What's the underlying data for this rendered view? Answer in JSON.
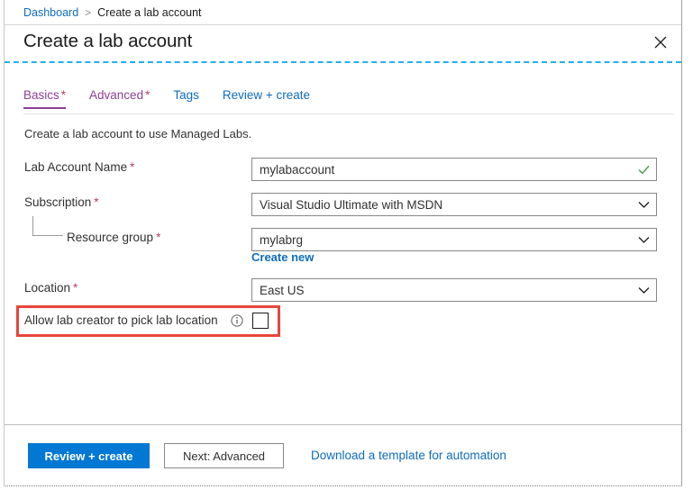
{
  "breadcrumb": {
    "parent": "Dashboard",
    "separator": ">",
    "current": "Create a lab account"
  },
  "header": {
    "title": "Create a lab account",
    "close_icon": "close-icon"
  },
  "tabs": [
    {
      "label": "Basics",
      "required": "*",
      "state": "active"
    },
    {
      "label": "Advanced",
      "required": "*",
      "state": "purple"
    },
    {
      "label": "Tags",
      "required": "",
      "state": "normal"
    },
    {
      "label": "Review + create",
      "required": "",
      "state": "normal"
    }
  ],
  "main": {
    "intro": "Create a lab account to use Managed Labs.",
    "fields": [
      {
        "label": "Lab Account Name",
        "required": "*",
        "value": "mylabaccount",
        "placeholder": "",
        "control": "textbox",
        "adornment": "checkmark-valid-icon"
      },
      {
        "label": "Subscription",
        "required": "*",
        "value": "Visual Studio Ultimate with MSDN",
        "placeholder": "",
        "control": "dropdown",
        "adornment": "chevron-down-icon"
      },
      {
        "label": "Resource group",
        "required": "*",
        "value": "mylabrg",
        "placeholder": "",
        "control": "dropdown",
        "adornment": "chevron-down-icon",
        "nested": true
      },
      {
        "label": "Location",
        "required": "*",
        "value": "East US",
        "placeholder": "",
        "control": "dropdown",
        "adornment": "chevron-down-icon"
      }
    ],
    "create_new_link": "Create new",
    "allow_location": {
      "label": "Allow lab creator to pick lab location",
      "info_icon": "info-circle-icon",
      "checked": false,
      "highlighted": true
    }
  },
  "footer": {
    "primary_button": "Review + create",
    "secondary_button": "Next: Advanced",
    "link": "Download a template for automation"
  },
  "colors": {
    "accent_blue": "#0078d4",
    "link_blue": "#0f6cbd",
    "tab_purple": "#8f3f97",
    "required_red": "#b4405e",
    "highlight_red": "#e8453c",
    "valid_green": "#4a9a4a",
    "dashed_divider": "#20b0ef"
  }
}
